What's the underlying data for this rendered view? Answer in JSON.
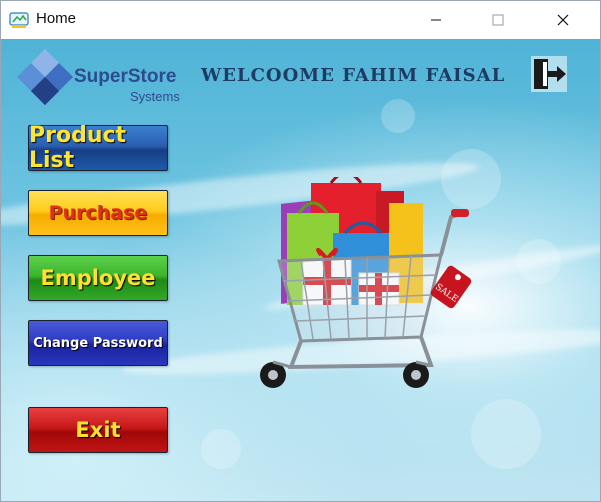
{
  "window": {
    "title": "Home",
    "minimize": "—",
    "maximize": "☐",
    "close": "✕"
  },
  "brand": {
    "name": "SuperStore",
    "sub": "Systems",
    "colors": {
      "dark": "#2e4b8f",
      "light": "#5b8fd6"
    }
  },
  "header": {
    "welcome": "WELCOOME FAHIM FAISAL"
  },
  "icons": {
    "logout": "logout-door-icon",
    "app": "app-icon",
    "cart": "shopping-cart-icon"
  },
  "menu": {
    "product_list": "Product List",
    "purchase": "Purchase",
    "employee": "Employee",
    "change_password": "Change Password",
    "exit": "Exit"
  },
  "cart": {
    "tag": "SALE"
  }
}
